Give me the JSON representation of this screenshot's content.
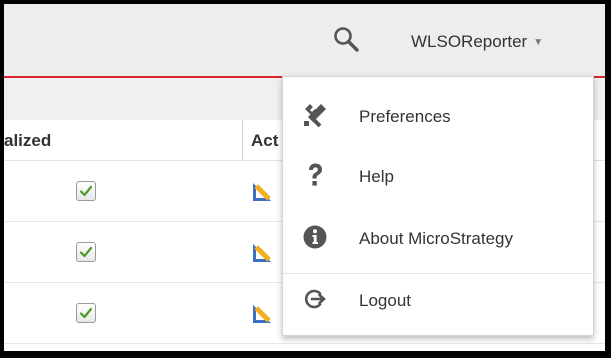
{
  "header": {
    "username": "WLSOReporter",
    "caret": "▼"
  },
  "table": {
    "columns": [
      "alized",
      "Act"
    ],
    "rows": [
      {
        "checked": true
      },
      {
        "checked": true
      },
      {
        "checked": true
      }
    ]
  },
  "user_menu": {
    "items": [
      {
        "label": "Preferences",
        "icon": "wrench-screwdriver-icon"
      },
      {
        "label": "Help",
        "icon": "question-mark-icon"
      },
      {
        "label": "About MicroStrategy",
        "icon": "info-circle-icon"
      },
      {
        "label": "Logout",
        "icon": "logout-icon"
      }
    ]
  },
  "colors": {
    "accent": "#d9272e",
    "topbar": "#ededed",
    "icon": "#555555"
  }
}
